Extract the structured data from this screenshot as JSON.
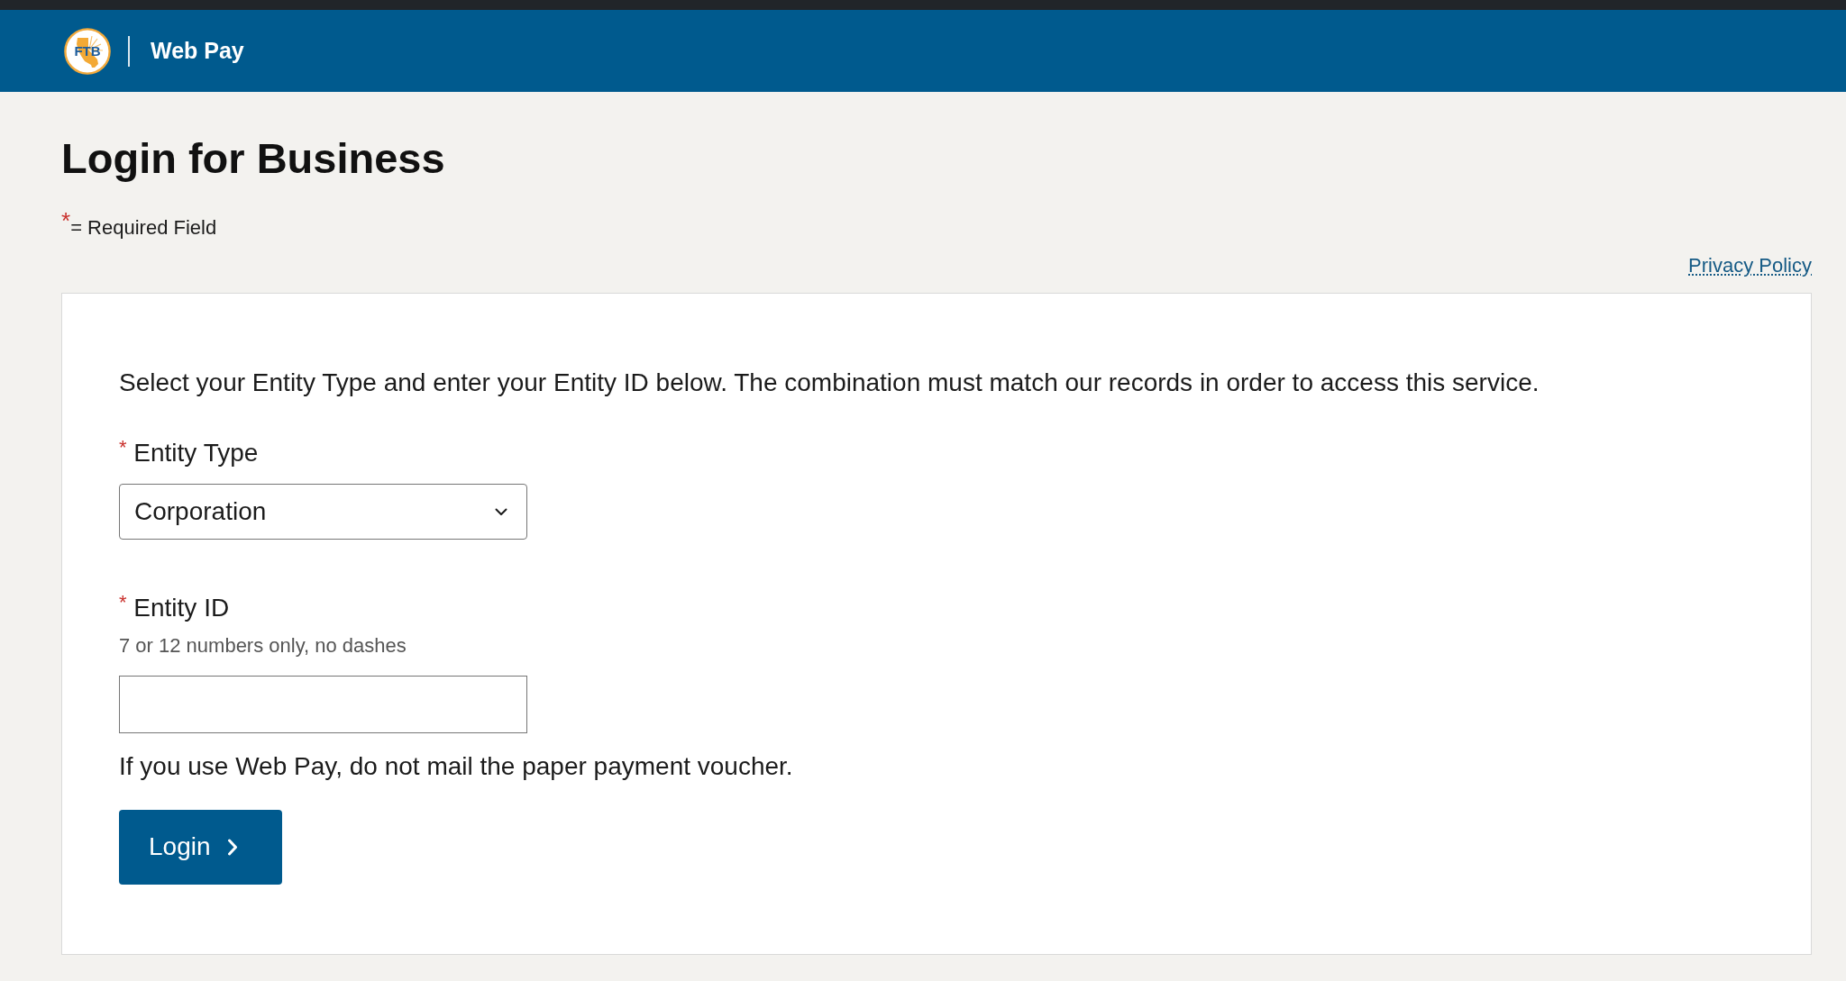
{
  "header": {
    "logo_text": "FTB",
    "title": "Web Pay"
  },
  "page": {
    "title": "Login for Business",
    "required_note": "$^{*}$= Required Field",
    "privacy_link": "Privacy Policy"
  },
  "form": {
    "intro": "Select your Entity Type and enter your Entity ID below. The combination must match our records in order to access this service.",
    "fields": [
      {
        "kind": "select",
        "label": "$^{*}$ Entity Type",
        "value": "Corporation"
      },
      {
        "kind": "text",
        "label": "$^{*}$ Entity ID",
        "hint": "7 or 12 numbers only, no dashes"
      }
    ],
    "notice": "If you use Web Pay, do not mail the paper payment voucher.",
    "submit": {
      "label": "Login"
    }
  }
}
